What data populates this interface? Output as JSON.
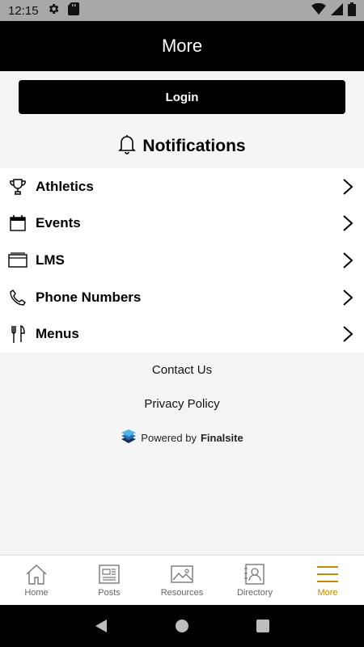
{
  "status_bar": {
    "time": "12:15"
  },
  "header": {
    "title": "More"
  },
  "login": {
    "label": "Login"
  },
  "notifications": {
    "label": "Notifications"
  },
  "menu": {
    "items": [
      {
        "label": "Athletics",
        "icon": "trophy-icon"
      },
      {
        "label": "Events",
        "icon": "calendar-icon"
      },
      {
        "label": "LMS",
        "icon": "window-icon"
      },
      {
        "label": "Phone Numbers",
        "icon": "phone-icon"
      },
      {
        "label": "Menus",
        "icon": "fork-knife-icon"
      }
    ]
  },
  "footer": {
    "contact": "Contact Us",
    "privacy": "Privacy Policy",
    "powered_prefix": "Powered by",
    "powered_brand": "Finalsite"
  },
  "tabs": [
    {
      "label": "Home",
      "icon": "home-icon"
    },
    {
      "label": "Posts",
      "icon": "newspaper-icon"
    },
    {
      "label": "Resources",
      "icon": "image-icon"
    },
    {
      "label": "Directory",
      "icon": "contact-card-icon"
    },
    {
      "label": "More",
      "icon": "hamburger-icon",
      "active": true
    }
  ],
  "colors": {
    "accent": "#c58a00",
    "header_bg": "#000000",
    "status_bg": "#a8a8a8"
  }
}
